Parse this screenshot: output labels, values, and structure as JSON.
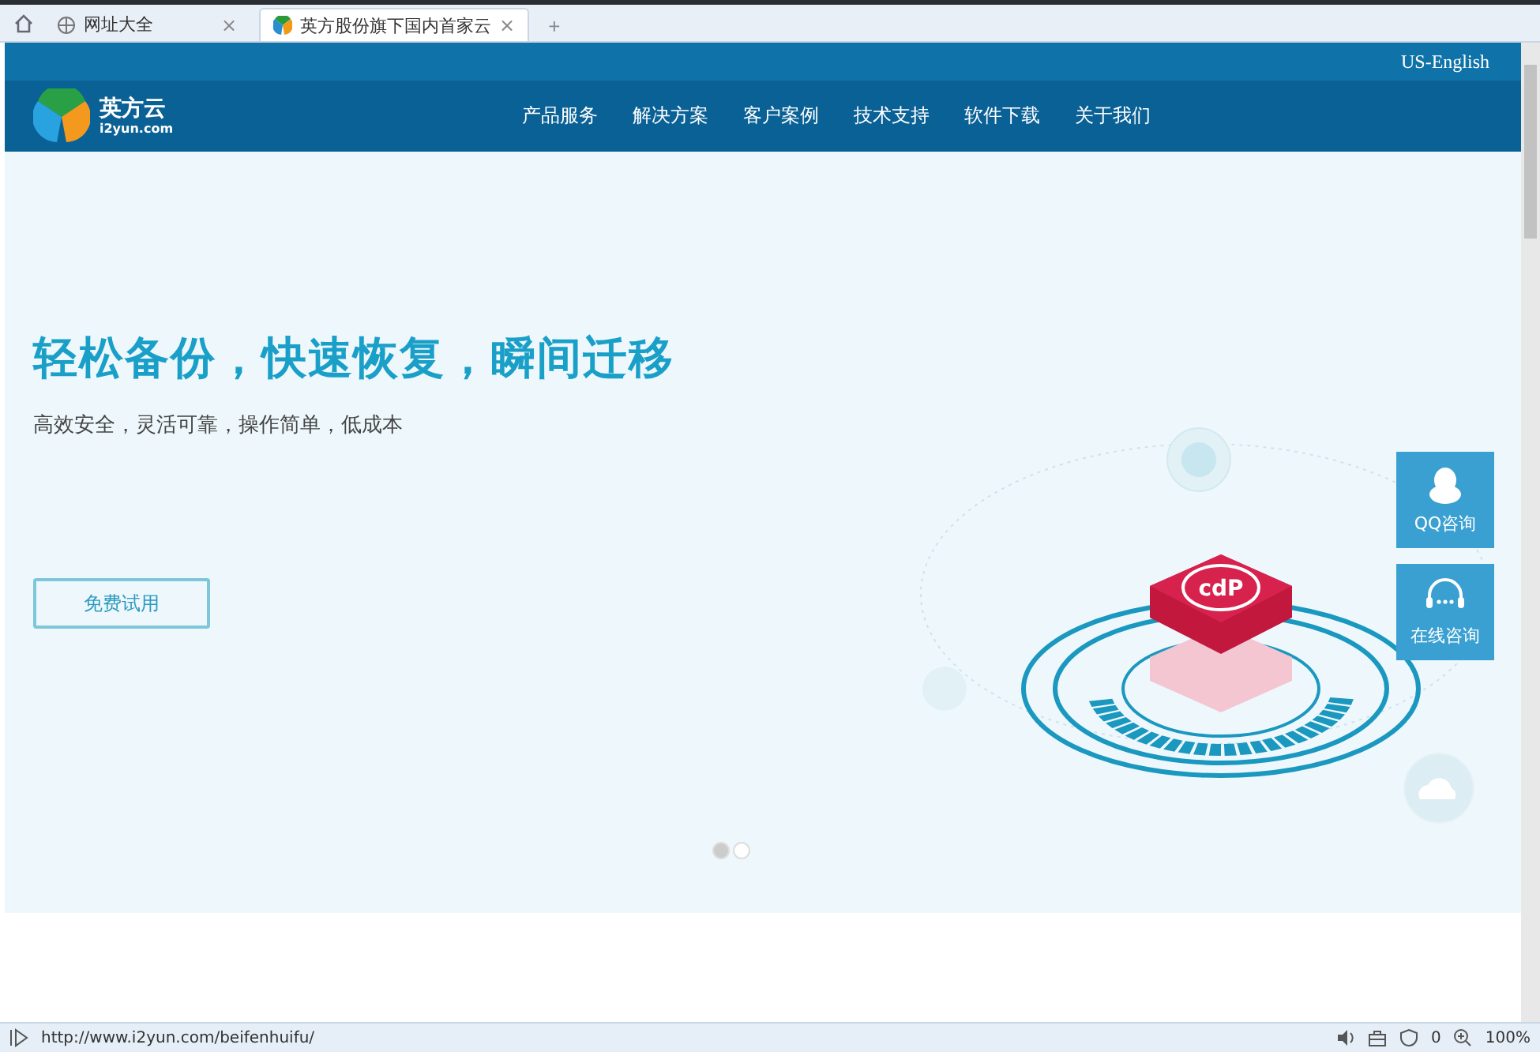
{
  "browser": {
    "tabs": [
      {
        "title": "网址大全",
        "selected": false,
        "close": "×"
      },
      {
        "title": "英方股份旗下国内首家云",
        "selected": true,
        "close": "×"
      }
    ],
    "new_tab": "+"
  },
  "header": {
    "language": "US-English",
    "logo": {
      "name": "英方云",
      "domain": "i2yun.com"
    },
    "nav": [
      {
        "label": "产品服务"
      },
      {
        "label": "解决方案"
      },
      {
        "label": "客户案例"
      },
      {
        "label": "技术支持"
      },
      {
        "label": "软件下载"
      },
      {
        "label": "关于我们"
      }
    ]
  },
  "hero": {
    "title": "轻松备份，快速恢复，瞬间迁移",
    "subtitle": "高效安全，灵活可靠，操作简单，低成本",
    "button": "免费试用",
    "badge": "cdP",
    "dots": [
      {
        "selected": true
      },
      {
        "selected": false
      }
    ]
  },
  "side_buttons": [
    {
      "kind": "qq",
      "label": "QQ咨询"
    },
    {
      "kind": "headset",
      "label": "在线咨询"
    }
  ],
  "status_bar": {
    "url": "http://www.i2yun.com/beifenhuifu/",
    "count": "0",
    "zoom": "100%"
  }
}
